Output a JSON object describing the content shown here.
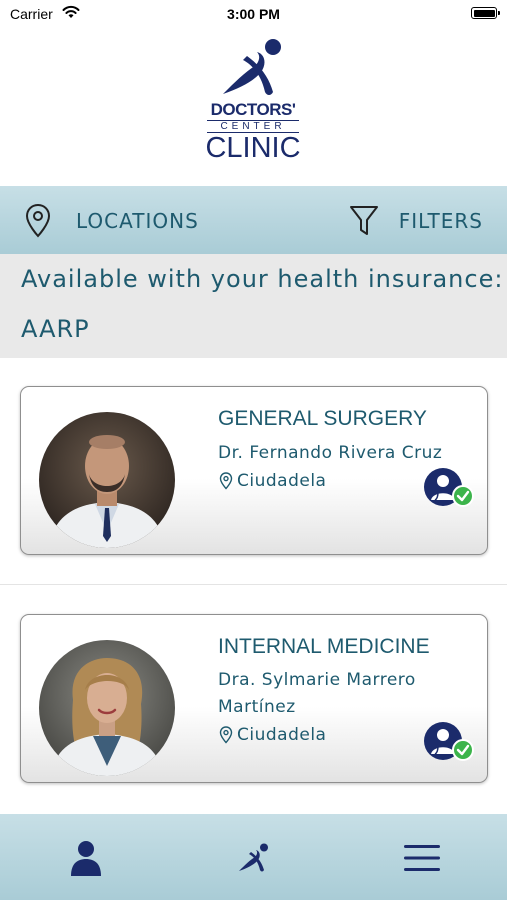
{
  "status_bar": {
    "carrier": "Carrier",
    "time": "3:00 PM"
  },
  "logo": {
    "line1": "DOCTORS'",
    "line2": "CENTER",
    "line3": "CLINIC"
  },
  "filter_bar": {
    "locations_label": "LOCATIONS",
    "filters_label": "FILTERS"
  },
  "insurance": {
    "title": "Available with your health insurance:",
    "value": "AARP"
  },
  "doctors": [
    {
      "specialty": "GENERAL SURGERY",
      "name": "Dr. Fernando Rivera Cruz",
      "location": "Ciudadela",
      "accepts_insurance": true
    },
    {
      "specialty": "INTERNAL MEDICINE",
      "name": "Dra. Sylmarie Marrero Martínez",
      "location": "Ciudadela",
      "accepts_insurance": true
    }
  ],
  "tab_bar": {
    "items": [
      "profile-icon",
      "clinic-logo-icon",
      "menu-icon"
    ]
  },
  "colors": {
    "brand_navy": "#1b2b6b",
    "text_teal": "#1e5a6e",
    "bar_blue": "#b5d3dc",
    "check_green": "#3cb44b"
  }
}
